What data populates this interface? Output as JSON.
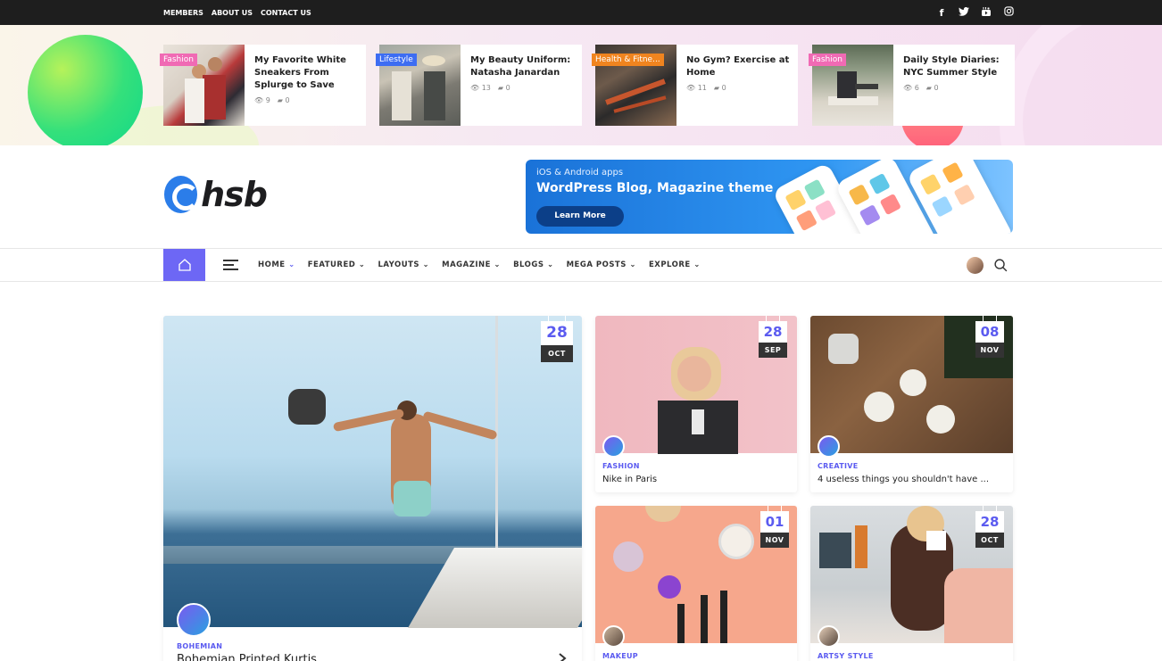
{
  "topbar": {
    "links": [
      "MEMBERS",
      "ABOUT US",
      "CONTACT US"
    ],
    "social": [
      {
        "name": "facebook-icon",
        "glyph": "f"
      },
      {
        "name": "twitter-icon",
        "glyph": "t"
      },
      {
        "name": "youtube-icon",
        "glyph": "▶"
      },
      {
        "name": "instagram-icon",
        "glyph": "◎"
      }
    ]
  },
  "trending": [
    {
      "tag": "Fashion",
      "tag_color": "#f06ab4",
      "title": "My Favorite White Sneakers From Splurge to Save",
      "views": "9",
      "comments": "0"
    },
    {
      "tag": "Lifestyle",
      "tag_color": "#3d6df2",
      "title": "My Beauty Uniform: Natasha Janardan",
      "views": "13",
      "comments": "0"
    },
    {
      "tag": "Health & Fitne...",
      "tag_color": "#f0841f",
      "title": "No Gym? Exercise at Home",
      "views": "11",
      "comments": "0"
    },
    {
      "tag": "Fashion",
      "tag_color": "#f06ab4",
      "title": "Daily Style Diaries: NYC Summer Style",
      "views": "6",
      "comments": "0"
    }
  ],
  "header": {
    "logo_text": "hsb",
    "banner": {
      "small": "iOS & Android apps",
      "big": "WordPress Blog, Magazine theme",
      "button": "Learn More"
    }
  },
  "nav": {
    "items": [
      "HOME",
      "FEATURED",
      "LAYOUTS",
      "MAGAZINE",
      "BLOGS",
      "MEGA POSTS",
      "EXPLORE"
    ],
    "active_index": 0,
    "accent": "#6d67f5"
  },
  "posts": [
    {
      "day": "28",
      "month": "OCT",
      "category": "BOHEMIAN",
      "title": "Bohemian Printed Kurtis"
    },
    {
      "day": "28",
      "month": "SEP",
      "category": "FASHION",
      "title": "Nike in Paris"
    },
    {
      "day": "08",
      "month": "NOV",
      "category": "CREATIVE",
      "title": "4 useless things you shouldn't have ..."
    },
    {
      "day": "01",
      "month": "NOV",
      "category": "MAKEUP",
      "title": ""
    },
    {
      "day": "28",
      "month": "OCT",
      "category": "ARTSY STYLE",
      "title": ""
    }
  ]
}
